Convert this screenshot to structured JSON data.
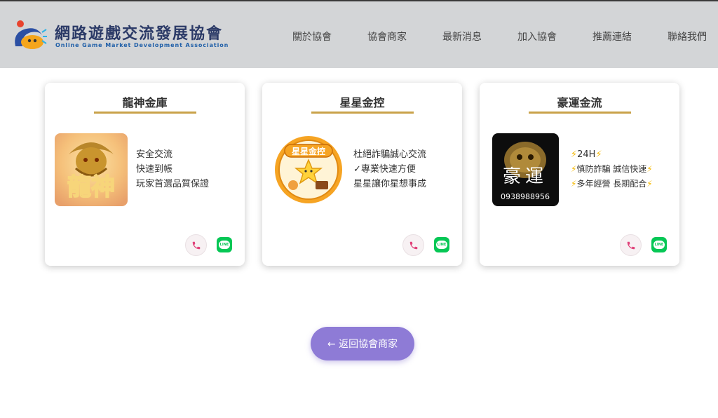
{
  "header": {
    "logo_title": "網路遊戲交流發展協會",
    "logo_subtitle": "Online Game Market Development Association",
    "nav": [
      {
        "label": "關於協會"
      },
      {
        "label": "協會商家"
      },
      {
        "label": "最新消息"
      },
      {
        "label": "加入協會"
      },
      {
        "label": "推薦連結"
      },
      {
        "label": "聯絡我們"
      }
    ]
  },
  "cards": [
    {
      "title": "龍神金庫",
      "image_text": "龍神",
      "lines": [
        "安全交流",
        "快速到帳",
        "玩家首選品質保證"
      ]
    },
    {
      "title": "星星金控",
      "image_text": "星星金控",
      "lines": [
        "杜絕詐騙誠心交流",
        "✓專業快速方便",
        "星星讓你星想事成"
      ]
    },
    {
      "title": "豪運金流",
      "image_text": "豪運",
      "image_number": "0938988956",
      "lines": [
        "24H",
        "慎防詐騙 誠信快速",
        "多年經營 長期配合"
      ]
    }
  ],
  "line_label": "LINE",
  "back_button": {
    "label": "← 返回協會商家"
  },
  "colors": {
    "header_bg": "#d3d5d7",
    "accent_gold": "#c9a24a",
    "button_purple": "#8e7bd6",
    "line_green": "#06c755"
  }
}
